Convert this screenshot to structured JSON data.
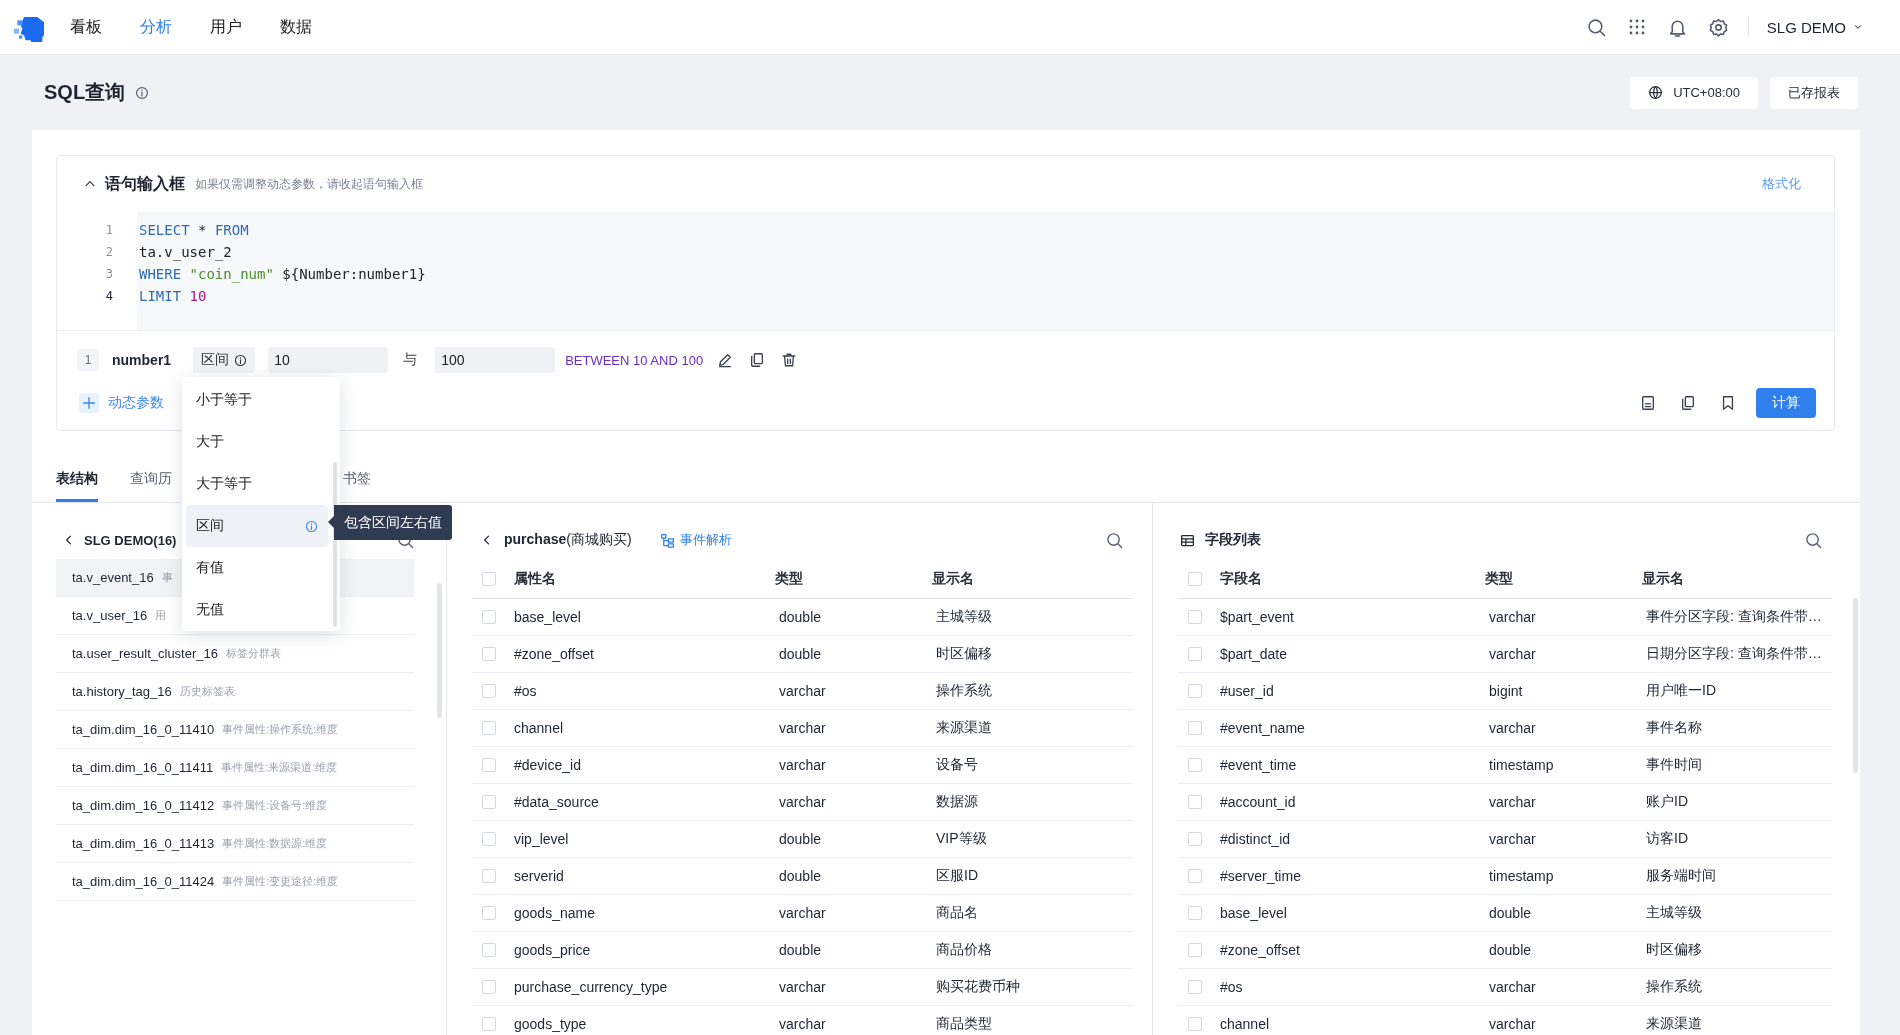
{
  "nav": {
    "items": [
      {
        "label": "看板",
        "selected": false
      },
      {
        "label": "分析",
        "selected": true
      },
      {
        "label": "用户",
        "selected": false
      },
      {
        "label": "数据",
        "selected": false
      }
    ],
    "account": "SLG DEMO"
  },
  "page": {
    "title": "SQL查询",
    "timezone": "UTC+08:00",
    "saved_reports": "已存报表"
  },
  "editor": {
    "title": "语句输入框",
    "hint": "如果仅需调整动态参数，请收起语句输入框",
    "format": "格式化",
    "expanded": true,
    "lines": [
      {
        "number": "1",
        "active": false,
        "tokens": [
          {
            "text": "SELECT",
            "kind": "keyword"
          },
          {
            "text": " * ",
            "kind": "plain"
          },
          {
            "text": "FROM",
            "kind": "keyword"
          }
        ]
      },
      {
        "number": "2",
        "active": false,
        "tokens": [
          {
            "text": "ta.v_user_2",
            "kind": "plain"
          }
        ]
      },
      {
        "number": "3",
        "active": false,
        "tokens": [
          {
            "text": "WHERE ",
            "kind": "keyword"
          },
          {
            "text": "\"coin_num\"",
            "kind": "string"
          },
          {
            "text": " ${Number:number1}",
            "kind": "plain"
          }
        ]
      },
      {
        "number": "4",
        "active": true,
        "tokens": [
          {
            "text": "LIMIT ",
            "kind": "keyword"
          },
          {
            "text": "10",
            "kind": "number"
          }
        ]
      }
    ]
  },
  "params": [
    {
      "index": "1",
      "name": "number1",
      "operator": "区间",
      "from": "10",
      "joiner": "与",
      "to": "100",
      "preview": "BETWEEN 10 AND 100"
    }
  ],
  "add_param": "动态参数",
  "run": "计算",
  "operator_menu": {
    "items": [
      {
        "label": "小于等于",
        "selected": false,
        "info": false
      },
      {
        "label": "大于",
        "selected": false,
        "info": false
      },
      {
        "label": "大于等于",
        "selected": false,
        "info": false
      },
      {
        "label": "区间",
        "selected": true,
        "info": true
      },
      {
        "label": "有值",
        "selected": false,
        "info": false
      },
      {
        "label": "无值",
        "selected": false,
        "info": false
      }
    ],
    "tooltip": "包含区间左右值"
  },
  "tabs": [
    {
      "label": "表结构",
      "selected": true
    },
    {
      "label": "查询历",
      "selected": false
    },
    {
      "label": "书签",
      "selected": false
    }
  ],
  "databases": {
    "title": "SLG DEMO(16)",
    "tables": [
      {
        "name": "ta.v_event_16",
        "description": "事",
        "selected": true
      },
      {
        "name": "ta.v_user_16",
        "description": "用",
        "selected": false
      },
      {
        "name": "ta.user_result_cluster_16",
        "description": "标签分群表",
        "selected": false
      },
      {
        "name": "ta.history_tag_16",
        "description": "历史标签表",
        "selected": false
      },
      {
        "name": "ta_dim.dim_16_0_11410",
        "description": "事件属性:操作系统:维度",
        "selected": false
      },
      {
        "name": "ta_dim.dim_16_0_11411",
        "description": "事件属性:来源渠道:维度",
        "selected": false
      },
      {
        "name": "ta_dim.dim_16_0_11412",
        "description": "事件属性:设备号:维度",
        "selected": false
      },
      {
        "name": "ta_dim.dim_16_0_11413",
        "description": "事件属性:数据源:维度",
        "selected": false
      },
      {
        "name": "ta_dim.dim_16_0_11424",
        "description": "事件属性:变更途径:维度",
        "selected": false
      }
    ]
  },
  "event": {
    "title": "**purchase**(商城购买)",
    "parse_link": "事件解析",
    "all_checked": false,
    "columns": [
      "属性名",
      "类型",
      "显示名"
    ],
    "rows": [
      {
        "name": "base_level",
        "type": "double",
        "display": "主城等级",
        "checked": false
      },
      {
        "name": "#zone_offset",
        "type": "double",
        "display": "时区偏移",
        "checked": false
      },
      {
        "name": "#os",
        "type": "varchar",
        "display": "操作系统",
        "checked": false
      },
      {
        "name": "channel",
        "type": "varchar",
        "display": "来源渠道",
        "checked": false
      },
      {
        "name": "#device_id",
        "type": "varchar",
        "display": "设备号",
        "checked": false
      },
      {
        "name": "#data_source",
        "type": "varchar",
        "display": "数据源",
        "checked": false
      },
      {
        "name": "vip_level",
        "type": "double",
        "display": "VIP等级",
        "checked": false
      },
      {
        "name": "serverid",
        "type": "double",
        "display": "区服ID",
        "checked": false
      },
      {
        "name": "goods_name",
        "type": "varchar",
        "display": "商品名",
        "checked": false
      },
      {
        "name": "goods_price",
        "type": "double",
        "display": "商品价格",
        "checked": false
      },
      {
        "name": "purchase_currency_type",
        "type": "varchar",
        "display": "购买花费币种",
        "checked": false
      },
      {
        "name": "goods_type",
        "type": "varchar",
        "display": "商品类型",
        "checked": false
      }
    ]
  },
  "fields": {
    "title": "字段列表",
    "all_checked": false,
    "columns": [
      "字段名",
      "类型",
      "显示名"
    ],
    "rows": [
      {
        "name": "$part_event",
        "type": "varchar",
        "display": "事件分区字段: 查询条件带…",
        "checked": false
      },
      {
        "name": "$part_date",
        "type": "varchar",
        "display": "日期分区字段: 查询条件带…",
        "checked": false
      },
      {
        "name": "#user_id",
        "type": "bigint",
        "display": "用户唯一ID",
        "checked": false
      },
      {
        "name": "#event_name",
        "type": "varchar",
        "display": "事件名称",
        "checked": false
      },
      {
        "name": "#event_time",
        "type": "timestamp",
        "display": "事件时间",
        "checked": false
      },
      {
        "name": "#account_id",
        "type": "varchar",
        "display": "账户ID",
        "checked": false
      },
      {
        "name": "#distinct_id",
        "type": "varchar",
        "display": "访客ID",
        "checked": false
      },
      {
        "name": "#server_time",
        "type": "timestamp",
        "display": "服务端时间",
        "checked": false
      },
      {
        "name": "base_level",
        "type": "double",
        "display": "主城等级",
        "checked": false
      },
      {
        "name": "#zone_offset",
        "type": "double",
        "display": "时区偏移",
        "checked": false
      },
      {
        "name": "#os",
        "type": "varchar",
        "display": "操作系统",
        "checked": false
      },
      {
        "name": "channel",
        "type": "varchar",
        "display": "来源渠道",
        "checked": false
      }
    ]
  }
}
